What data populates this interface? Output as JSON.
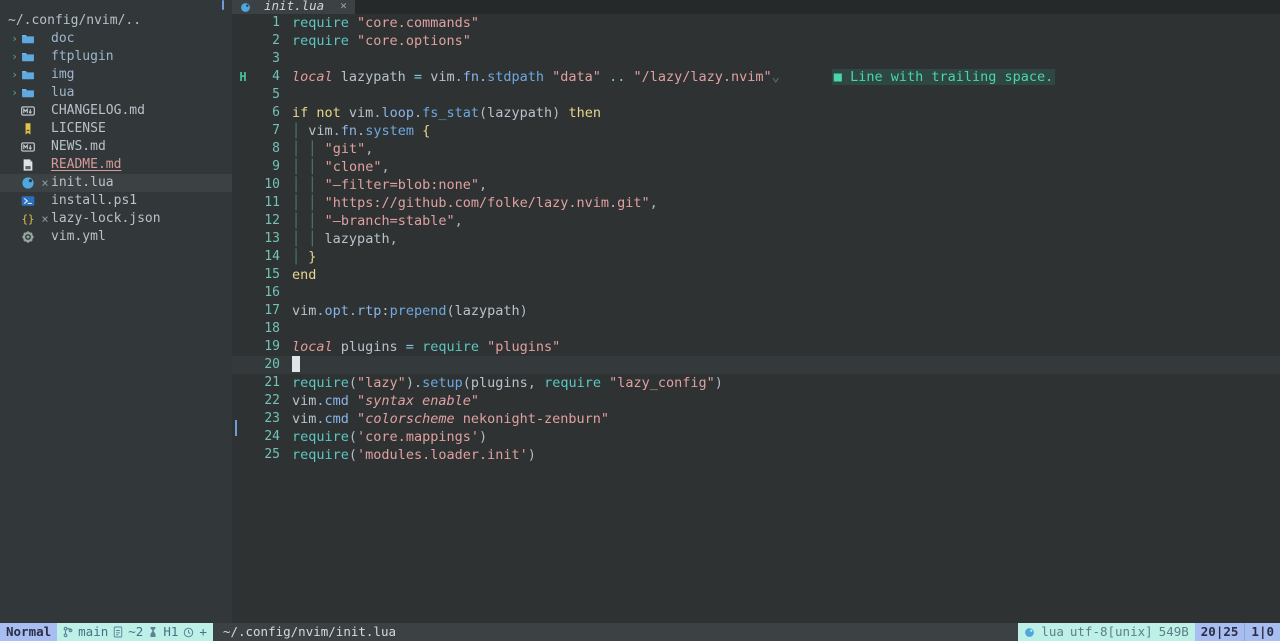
{
  "app": {
    "name": "neovim-editor"
  },
  "sidebar": {
    "root_label": "~/.config/nvim/..",
    "items": [
      {
        "kind": "dir",
        "chevron": "›",
        "icon": "folder-icon",
        "label": "doc",
        "modified": ""
      },
      {
        "kind": "dir",
        "chevron": "›",
        "icon": "folder-icon",
        "label": "ftplugin",
        "modified": ""
      },
      {
        "kind": "dir",
        "chevron": "›",
        "icon": "folder-icon",
        "label": "img",
        "modified": ""
      },
      {
        "kind": "dir",
        "chevron": "›",
        "icon": "folder-icon",
        "label": "lua",
        "modified": ""
      },
      {
        "kind": "file",
        "chevron": "",
        "icon": "markdown-icon",
        "label": "CHANGELOG.md",
        "modified": ""
      },
      {
        "kind": "file",
        "chevron": "",
        "icon": "license-icon",
        "label": "LICENSE",
        "modified": ""
      },
      {
        "kind": "file",
        "chevron": "",
        "icon": "markdown-icon",
        "label": "NEWS.md",
        "modified": ""
      },
      {
        "kind": "file",
        "chevron": "",
        "icon": "readme-icon",
        "label": "README.md",
        "modified": ""
      },
      {
        "kind": "file",
        "chevron": "",
        "icon": "lua-moon-icon",
        "label": "init.lua",
        "modified": "×"
      },
      {
        "kind": "file",
        "chevron": "",
        "icon": "powershell-icon",
        "label": "install.ps1",
        "modified": ""
      },
      {
        "kind": "file",
        "chevron": "",
        "icon": "json-braces-icon",
        "label": "lazy-lock.json",
        "modified": "×"
      },
      {
        "kind": "file",
        "chevron": "",
        "icon": "gear-icon",
        "label": "vim.yml",
        "modified": ""
      }
    ],
    "selected_index": 8
  },
  "tabline": {
    "tabs": [
      {
        "icon": "lua-moon-icon",
        "label": "init.lua",
        "close": "✕"
      }
    ]
  },
  "editor": {
    "cursor_line": 20,
    "trailing_space_glyph": "⌄",
    "diagnostic": {
      "marker": "■",
      "text": "Line with trailing space."
    },
    "lines": [
      {
        "n": 1,
        "sign": "",
        "gitbar": false,
        "tokens": [
          {
            "t": "require",
            "c": "req"
          },
          {
            "t": " ",
            "c": "ident"
          },
          {
            "t": "\"core.commands\"",
            "c": "str"
          }
        ]
      },
      {
        "n": 2,
        "sign": "",
        "gitbar": false,
        "tokens": [
          {
            "t": "require",
            "c": "req"
          },
          {
            "t": " ",
            "c": "ident"
          },
          {
            "t": "\"core.options\"",
            "c": "str"
          }
        ]
      },
      {
        "n": 3,
        "sign": "",
        "gitbar": false,
        "tokens": []
      },
      {
        "n": 4,
        "sign": "H",
        "gitbar": false,
        "tokens": [
          {
            "t": "local",
            "c": "loc"
          },
          {
            "t": " lazypath ",
            "c": "ident"
          },
          {
            "t": "=",
            "c": "op"
          },
          {
            "t": " vim",
            "c": "ident"
          },
          {
            "t": ".fn",
            "c": "fld"
          },
          {
            "t": ".",
            "c": "punct"
          },
          {
            "t": "stdpath",
            "c": "fn"
          },
          {
            "t": " ",
            "c": "ident"
          },
          {
            "t": "\"data\"",
            "c": "str"
          },
          {
            "t": " ",
            "c": "ident"
          },
          {
            "t": "..",
            "c": "op"
          },
          {
            "t": " ",
            "c": "ident"
          },
          {
            "t": "\"/lazy/lazy.nvim\"",
            "c": "str"
          }
        ],
        "trailing_space": true,
        "diagnostic": true
      },
      {
        "n": 5,
        "sign": "",
        "gitbar": false,
        "tokens": []
      },
      {
        "n": 6,
        "sign": "",
        "gitbar": false,
        "tokens": [
          {
            "t": "if",
            "c": "kw"
          },
          {
            "t": " ",
            "c": "ident"
          },
          {
            "t": "not",
            "c": "kw"
          },
          {
            "t": " vim",
            "c": "ident"
          },
          {
            "t": ".loop",
            "c": "fld"
          },
          {
            "t": ".",
            "c": "punct"
          },
          {
            "t": "fs_stat",
            "c": "fn"
          },
          {
            "t": "(",
            "c": "punct"
          },
          {
            "t": "lazypath",
            "c": "ident"
          },
          {
            "t": ")",
            "c": "punct"
          },
          {
            "t": " ",
            "c": "ident"
          },
          {
            "t": "then",
            "c": "kw"
          }
        ]
      },
      {
        "n": 7,
        "sign": "",
        "gitbar": false,
        "tokens": [
          {
            "t": "│",
            "c": "ig"
          },
          {
            "t": " vim",
            "c": "ident"
          },
          {
            "t": ".fn",
            "c": "fld"
          },
          {
            "t": ".",
            "c": "punct"
          },
          {
            "t": "system",
            "c": "fn"
          },
          {
            "t": " ",
            "c": "ident"
          },
          {
            "t": "{",
            "c": "kw"
          }
        ]
      },
      {
        "n": 8,
        "sign": "",
        "gitbar": false,
        "tokens": [
          {
            "t": "│",
            "c": "ig"
          },
          {
            "t": " ",
            "c": "ident"
          },
          {
            "t": "│",
            "c": "ig"
          },
          {
            "t": " ",
            "c": "ident"
          },
          {
            "t": "\"git\"",
            "c": "str"
          },
          {
            "t": ",",
            "c": "punct"
          }
        ]
      },
      {
        "n": 9,
        "sign": "",
        "gitbar": false,
        "tokens": [
          {
            "t": "│",
            "c": "ig"
          },
          {
            "t": " ",
            "c": "ident"
          },
          {
            "t": "│",
            "c": "ig"
          },
          {
            "t": " ",
            "c": "ident"
          },
          {
            "t": "\"clone\"",
            "c": "str"
          },
          {
            "t": ",",
            "c": "punct"
          }
        ]
      },
      {
        "n": 10,
        "sign": "",
        "gitbar": false,
        "tokens": [
          {
            "t": "│",
            "c": "ig"
          },
          {
            "t": " ",
            "c": "ident"
          },
          {
            "t": "│",
            "c": "ig"
          },
          {
            "t": " ",
            "c": "ident"
          },
          {
            "t": "\"—filter=blob:none\"",
            "c": "str"
          },
          {
            "t": ",",
            "c": "punct"
          }
        ]
      },
      {
        "n": 11,
        "sign": "",
        "gitbar": false,
        "tokens": [
          {
            "t": "│",
            "c": "ig"
          },
          {
            "t": " ",
            "c": "ident"
          },
          {
            "t": "│",
            "c": "ig"
          },
          {
            "t": " ",
            "c": "ident"
          },
          {
            "t": "\"https://github.com/folke/lazy.nvim.git\"",
            "c": "str"
          },
          {
            "t": ",",
            "c": "punct"
          }
        ]
      },
      {
        "n": 12,
        "sign": "",
        "gitbar": false,
        "tokens": [
          {
            "t": "│",
            "c": "ig"
          },
          {
            "t": " ",
            "c": "ident"
          },
          {
            "t": "│",
            "c": "ig"
          },
          {
            "t": " ",
            "c": "ident"
          },
          {
            "t": "\"—branch=stable\"",
            "c": "str"
          },
          {
            "t": ",",
            "c": "punct"
          }
        ]
      },
      {
        "n": 13,
        "sign": "",
        "gitbar": false,
        "tokens": [
          {
            "t": "│",
            "c": "ig"
          },
          {
            "t": " ",
            "c": "ident"
          },
          {
            "t": "│",
            "c": "ig"
          },
          {
            "t": " lazypath",
            "c": "ident"
          },
          {
            "t": ",",
            "c": "punct"
          }
        ]
      },
      {
        "n": 14,
        "sign": "",
        "gitbar": false,
        "tokens": [
          {
            "t": "│",
            "c": "ig"
          },
          {
            "t": " ",
            "c": "ident"
          },
          {
            "t": "}",
            "c": "kw"
          }
        ]
      },
      {
        "n": 15,
        "sign": "",
        "gitbar": false,
        "tokens": [
          {
            "t": "end",
            "c": "kw"
          }
        ]
      },
      {
        "n": 16,
        "sign": "",
        "gitbar": false,
        "tokens": []
      },
      {
        "n": 17,
        "sign": "",
        "gitbar": false,
        "tokens": [
          {
            "t": "vim",
            "c": "ident"
          },
          {
            "t": ".opt",
            "c": "fld"
          },
          {
            "t": ".rtp",
            "c": "fld"
          },
          {
            "t": ":",
            "c": "punct"
          },
          {
            "t": "prepend",
            "c": "fn"
          },
          {
            "t": "(",
            "c": "punct"
          },
          {
            "t": "lazypath",
            "c": "ident"
          },
          {
            "t": ")",
            "c": "punct"
          }
        ]
      },
      {
        "n": 18,
        "sign": "",
        "gitbar": false,
        "tokens": []
      },
      {
        "n": 19,
        "sign": "",
        "gitbar": false,
        "tokens": [
          {
            "t": "local",
            "c": "loc"
          },
          {
            "t": " plugins ",
            "c": "ident"
          },
          {
            "t": "=",
            "c": "op"
          },
          {
            "t": " ",
            "c": "ident"
          },
          {
            "t": "require",
            "c": "req"
          },
          {
            "t": " ",
            "c": "ident"
          },
          {
            "t": "\"plugins\"",
            "c": "str"
          }
        ]
      },
      {
        "n": 20,
        "sign": "",
        "gitbar": false,
        "tokens": [],
        "cursor": true
      },
      {
        "n": 21,
        "sign": "",
        "gitbar": false,
        "tokens": [
          {
            "t": "require",
            "c": "req"
          },
          {
            "t": "(",
            "c": "punct"
          },
          {
            "t": "\"lazy\"",
            "c": "str"
          },
          {
            "t": ")",
            "c": "punct"
          },
          {
            "t": ".",
            "c": "punct"
          },
          {
            "t": "setup",
            "c": "fn"
          },
          {
            "t": "(",
            "c": "punct"
          },
          {
            "t": "plugins",
            "c": "ident"
          },
          {
            "t": ",",
            "c": "punct"
          },
          {
            "t": " ",
            "c": "ident"
          },
          {
            "t": "require",
            "c": "req"
          },
          {
            "t": " ",
            "c": "ident"
          },
          {
            "t": "\"lazy_config\"",
            "c": "str"
          },
          {
            "t": ")",
            "c": "punct"
          }
        ]
      },
      {
        "n": 22,
        "sign": "",
        "gitbar": false,
        "tokens": [
          {
            "t": "vim",
            "c": "ident"
          },
          {
            "t": ".cmd",
            "c": "fld"
          },
          {
            "t": " ",
            "c": "ident"
          },
          {
            "t": "\"syntax enable\"",
            "c": "stritl"
          }
        ]
      },
      {
        "n": 23,
        "sign": "",
        "gitbar": true,
        "tokens": [
          {
            "t": "vim",
            "c": "ident"
          },
          {
            "t": ".cmd",
            "c": "fld"
          },
          {
            "t": " ",
            "c": "ident"
          },
          {
            "t": "\"",
            "c": "str"
          },
          {
            "t": "colorscheme",
            "c": "stritl"
          },
          {
            "t": " nekonight-zenburn\"",
            "c": "str"
          }
        ]
      },
      {
        "n": 24,
        "sign": "",
        "gitbar": false,
        "tokens": [
          {
            "t": "require",
            "c": "req"
          },
          {
            "t": "(",
            "c": "punct"
          },
          {
            "t": "'core.mappings'",
            "c": "str"
          },
          {
            "t": ")",
            "c": "punct"
          }
        ]
      },
      {
        "n": 25,
        "sign": "",
        "gitbar": false,
        "tokens": [
          {
            "t": "require",
            "c": "req"
          },
          {
            "t": "(",
            "c": "punct"
          },
          {
            "t": "'modules.loader.init'",
            "c": "str"
          },
          {
            "t": ")",
            "c": "punct"
          }
        ]
      }
    ]
  },
  "statusline": {
    "mode": "Normal",
    "git_branch_icon": "branch-icon",
    "git_branch": "main",
    "diff_icon": "file-diff-icon",
    "diff_count": "~2",
    "diagnostic_icon": "warning-icon",
    "diagnostic_count": "H1",
    "clock_icon": "clock-icon",
    "clock_value": "+",
    "file_path": "~/.config/nvim/init.lua",
    "filetype_icon": "lua-moon-icon",
    "filetype": "lua",
    "encoding": "utf-8[unix]",
    "filesize": "549B",
    "position": "20|25",
    "column": "1|0"
  },
  "colors": {
    "bg": "#2e3233",
    "sidebar_bg": "#323739",
    "tabline_bg": "#25292a",
    "accent_blue": "#a8bdf0",
    "accent_teal": "#bdf0e6",
    "cursorline": "#343a3b",
    "keyword": "#e8d88a",
    "string": "#e0a0a0",
    "function": "#6fa8e0",
    "require": "#5bc8c0",
    "linenr": "#72c2b6",
    "diagnostic_hint": "#4ad6a8"
  }
}
